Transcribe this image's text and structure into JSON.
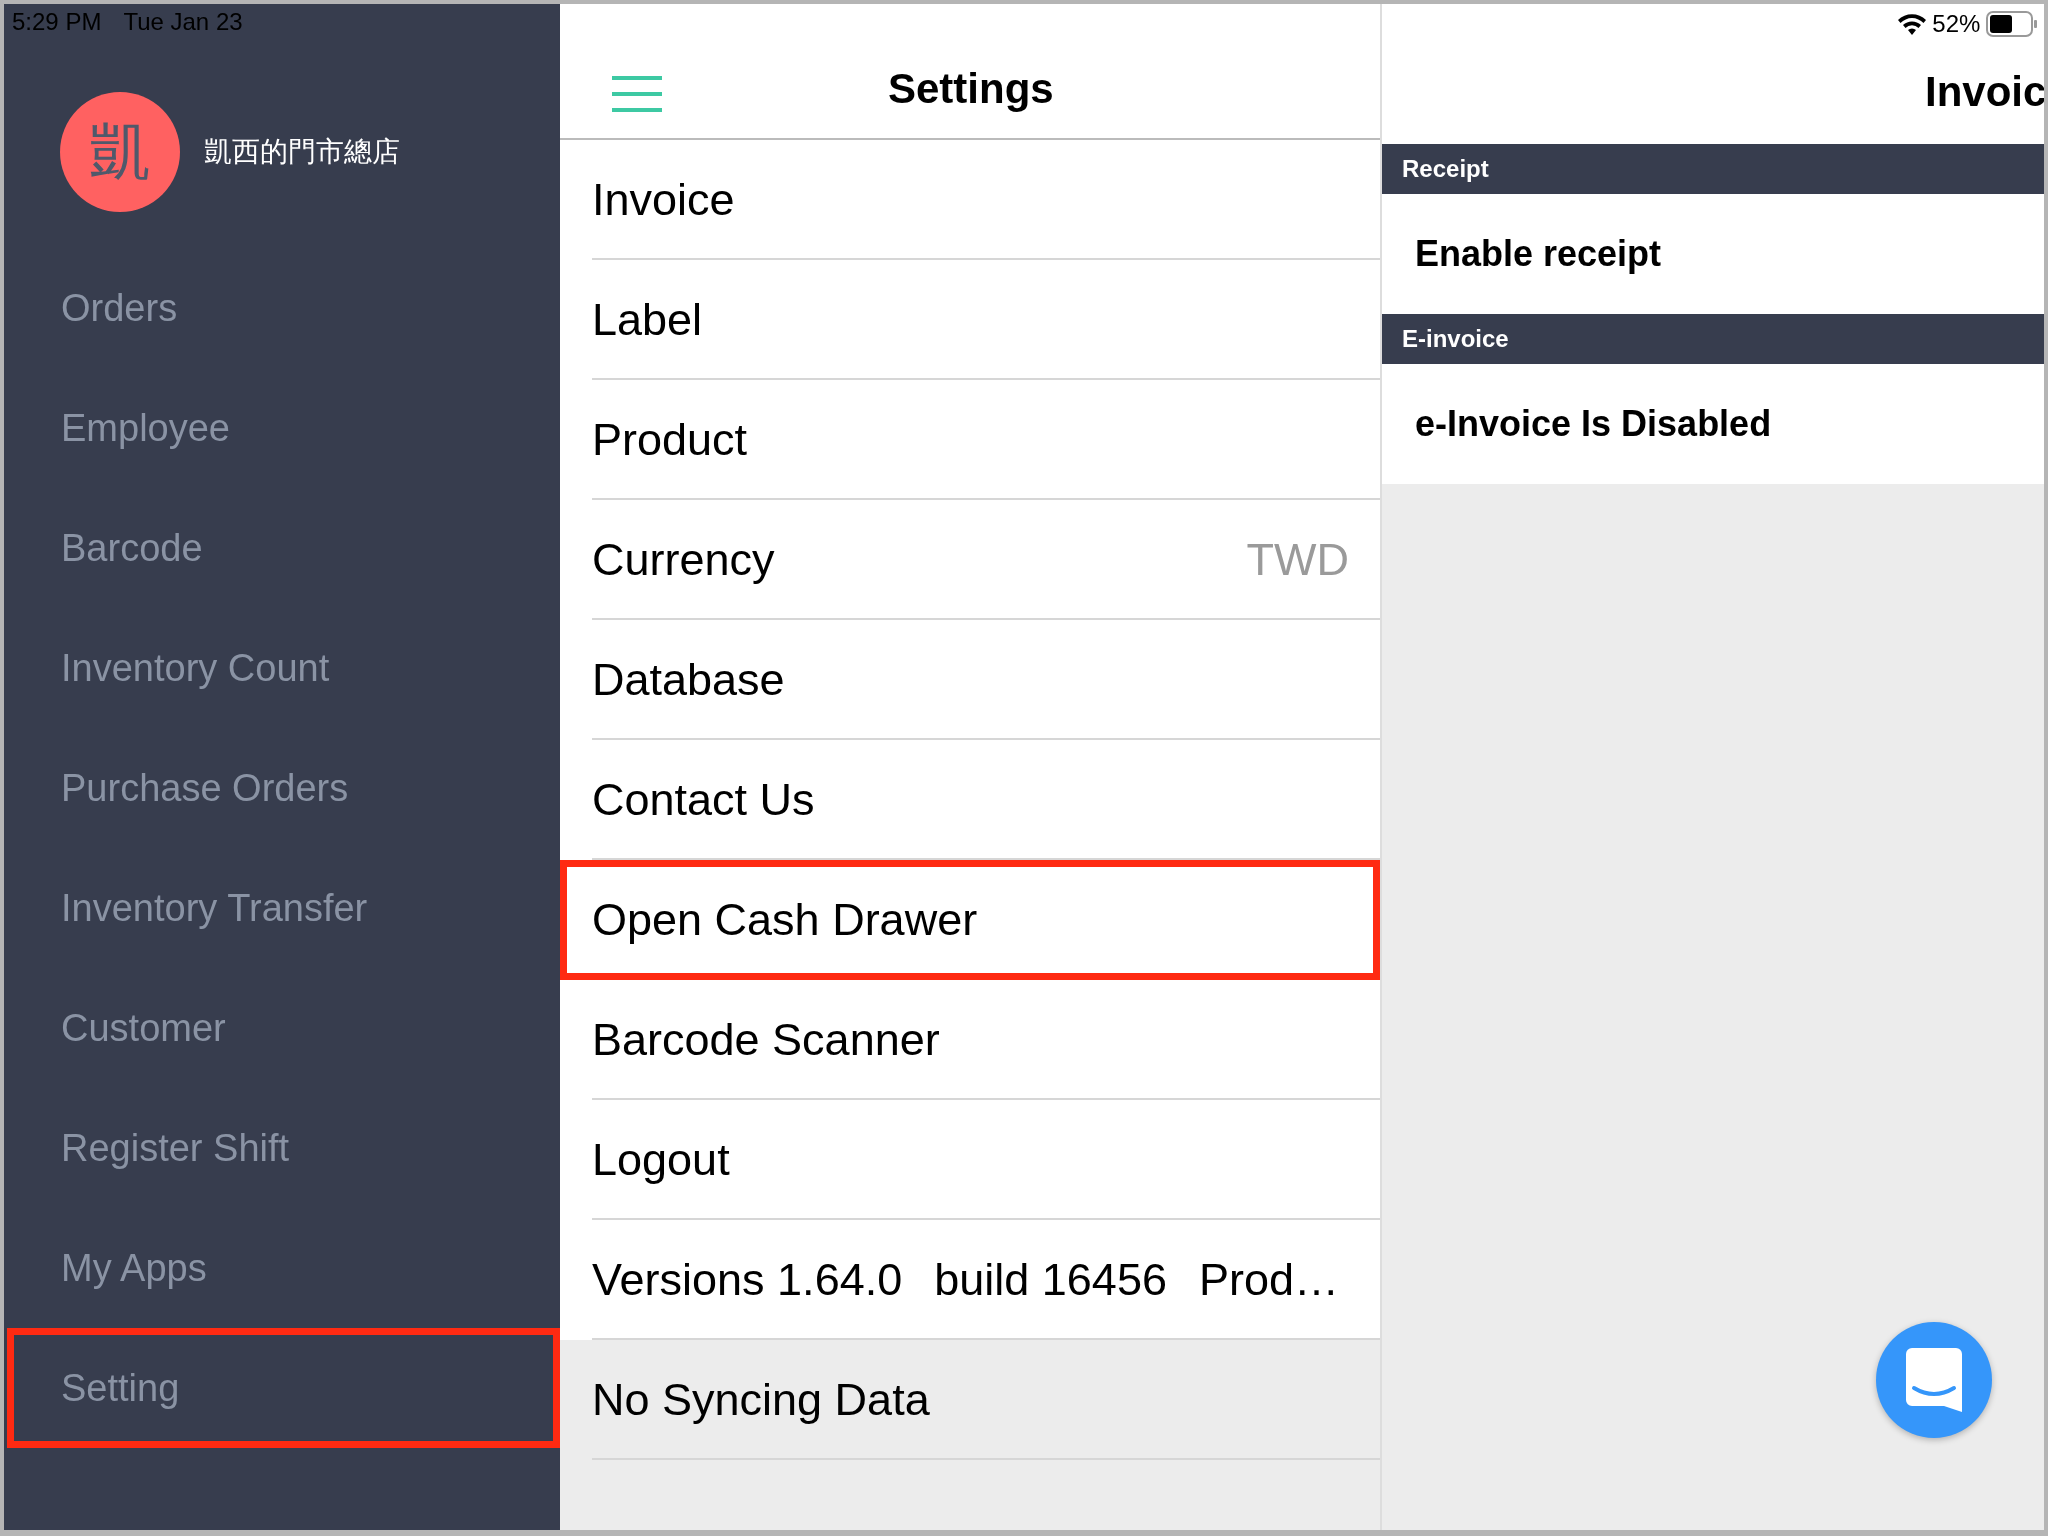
{
  "status_bar": {
    "time": "5:29 PM",
    "date": "Tue Jan 23",
    "battery": "52%"
  },
  "store": {
    "avatar_char": "凱",
    "name": "凱西的門市總店"
  },
  "sidebar": {
    "items": [
      {
        "label": "Orders",
        "highlighted": false
      },
      {
        "label": "Employee",
        "highlighted": false
      },
      {
        "label": "Barcode",
        "highlighted": false
      },
      {
        "label": "Inventory Count",
        "highlighted": false
      },
      {
        "label": "Purchase Orders",
        "highlighted": false
      },
      {
        "label": "Inventory Transfer",
        "highlighted": false
      },
      {
        "label": "Customer",
        "highlighted": false
      },
      {
        "label": "Register Shift",
        "highlighted": false
      },
      {
        "label": "My Apps",
        "highlighted": false
      },
      {
        "label": "Setting",
        "highlighted": true
      }
    ]
  },
  "settings": {
    "title": "Settings",
    "items": [
      {
        "kind": "link",
        "parts": [
          "Invoice"
        ],
        "highlighted": false
      },
      {
        "kind": "link",
        "parts": [
          "Label"
        ],
        "highlighted": false
      },
      {
        "kind": "link",
        "parts": [
          "Product"
        ],
        "highlighted": false
      },
      {
        "kind": "link",
        "parts": [
          "Currency"
        ],
        "value": "TWD",
        "highlighted": false
      },
      {
        "kind": "link",
        "parts": [
          "Database"
        ],
        "highlighted": false
      },
      {
        "kind": "link",
        "parts": [
          "Contact Us"
        ],
        "highlighted": false
      },
      {
        "kind": "link",
        "parts": [
          "Open Cash Drawer"
        ],
        "highlighted": true
      },
      {
        "kind": "link",
        "parts": [
          "Barcode Scanner"
        ],
        "highlighted": false
      },
      {
        "kind": "link",
        "parts": [
          "Logout"
        ],
        "highlighted": false
      },
      {
        "kind": "info",
        "parts": [
          "Versions 1.64.0",
          "build 16456",
          "Prod…"
        ],
        "highlighted": false
      },
      {
        "kind": "status",
        "parts": [
          "No Syncing Data"
        ],
        "highlighted": false
      }
    ]
  },
  "detail": {
    "title": "Invoic",
    "sections": [
      {
        "header": "Receipt",
        "rows": [
          "Enable receipt"
        ]
      },
      {
        "header": "E-invoice",
        "rows": [
          "e-Invoice Is Disabled"
        ]
      }
    ]
  }
}
